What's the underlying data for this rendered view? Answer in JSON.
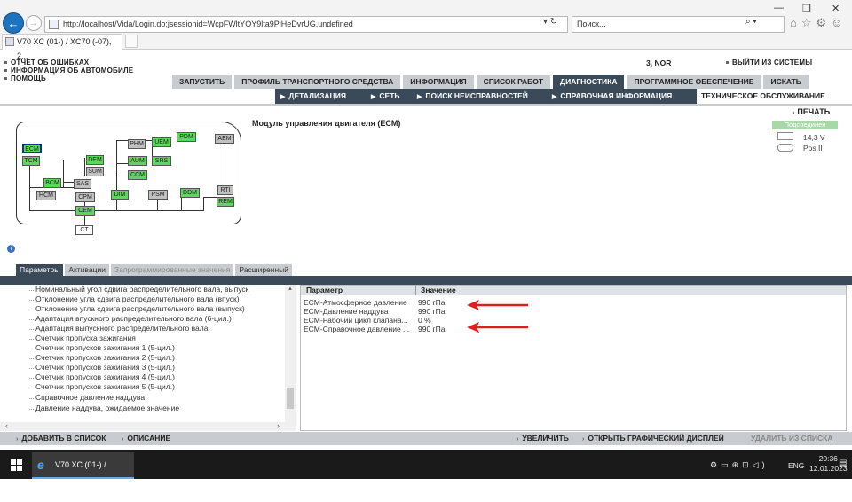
{
  "browser": {
    "url": "http://localhost/Vida/Login.do;jsessionid=WcpFWltYOY9lta9PlHeDvrUG.undefined",
    "search_placeholder": "Поиск...",
    "tab_title": "V70 XC (01-) / XC70 (-07), 2..."
  },
  "header": {
    "links": [
      "ОТЧЕТ ОБ ОШИБКАХ",
      "ИНФОРМАЦИЯ ОБ АВТОМОБИЛЕ",
      "ПОМОЩЬ"
    ],
    "user_code": "3, NOR",
    "logout": "ВЫЙТИ ИЗ СИСТЕМЫ"
  },
  "main_tabs": [
    {
      "label": "ЗАПУСТИТЬ",
      "active": false
    },
    {
      "label": "ПРОФИЛЬ ТРАНСПОРТНОГО СРЕДСТВА",
      "active": false
    },
    {
      "label": "ИНФОРМАЦИЯ",
      "active": false
    },
    {
      "label": "СПИСОК РАБОТ",
      "active": false
    },
    {
      "label": "ДИАГНОСТИКА",
      "active": true
    },
    {
      "label": "ПРОГРАММНОЕ ОБЕСПЕЧЕНИЕ",
      "active": false
    },
    {
      "label": "ИСКАТЬ",
      "active": false
    }
  ],
  "sub_tabs": [
    "ДЕТАЛИЗАЦИЯ",
    "СЕТЬ",
    "ПОИСК НЕИСПРАВНОСТЕЙ",
    "СПРАВОЧНАЯ ИНФОРМАЦИЯ"
  ],
  "sub_active": "ТЕХНИЧЕСКОЕ ОБСЛУЖИВАНИЕ",
  "module_title": "Модуль управления двигателя (ECM)",
  "print_label": "ПЕЧАТЬ",
  "status": {
    "state": "Подсоединен",
    "voltage": "14,3 V",
    "ignition": "Pos II"
  },
  "network_nodes": {
    "ecm": "ECM",
    "tcm": "TCM",
    "dem": "DEM",
    "sum": "SUM",
    "bcm": "BCM",
    "sas": "SAS",
    "hcm": "HCM",
    "cpm": "CPM",
    "cem": "CEM",
    "ct": "CT",
    "phm": "PHM",
    "uem": "UEM",
    "pdm": "PDM",
    "aum": "AUM",
    "srs": "SRS",
    "ccm": "CCM",
    "dim": "DIM",
    "psm": "PSM",
    "ddm": "DDM",
    "aem": "AEM",
    "rti": "RTI",
    "rem": "REM"
  },
  "lower_tabs": [
    {
      "label": "Параметры",
      "state": "active"
    },
    {
      "label": "Активации",
      "state": "normal"
    },
    {
      "label": "Запрограммированные значения",
      "state": "disabled"
    },
    {
      "label": "Расширенный",
      "state": "normal"
    }
  ],
  "param_list": [
    "Номинальный угол сдвига распределительного вала, выпуск",
    "Отклонение угла сдвига распределительного вала (впуск)",
    "Отклонение угла сдвига распределительного вала (выпуск)",
    "Адаптация впускного распределительного вала (6-цил.)",
    "Адаптация выпускного распределительного вала",
    "Счетчик пропуска зажигания",
    "Счетчик пропусков зажигания 1 (5-цил.)",
    "Счетчик пропусков зажигания 2 (5-цил.)",
    "Счетчик пропусков зажигания 3 (5-цил.)",
    "Счетчик пропусков зажигания 4 (5-цил.)",
    "Счетчик пропусков зажигания 5 (5-цил.)",
    "Справочное давление наддува",
    "Давление наддува, ожидаемое значение"
  ],
  "table": {
    "headers": [
      "Параметр",
      "Значение"
    ],
    "rows": [
      [
        "ECM-Атмосферное давление",
        "990 гПа"
      ],
      [
        "ECM-Давление наддува",
        "990 гПа"
      ],
      [
        "ECM-Рабочий цикл клапана...",
        "0 %"
      ],
      [
        "ECM-Справочное давление ...",
        "990 гПа"
      ]
    ]
  },
  "bottom_actions": {
    "add": "ДОБАВИТЬ В СПИСОК",
    "describe": "ОПИСАНИЕ",
    "zoom": "УВЕЛИЧИТЬ",
    "graph": "ОТКРЫТЬ ГРАФИЧЕСКИЙ ДИСПЛЕЙ",
    "remove": "УДАЛИТЬ ИЗ СПИСКА"
  },
  "taskbar": {
    "app": "V70 XC (01-) / XC70...",
    "lang": "ENG",
    "time": "20:36",
    "date": "12.01.2023"
  },
  "colors": {
    "accent_dark": "#3a4a58",
    "tab_grey": "#c8ccd0",
    "node_green": "#5cd65c",
    "arrow_red": "#e02020"
  }
}
